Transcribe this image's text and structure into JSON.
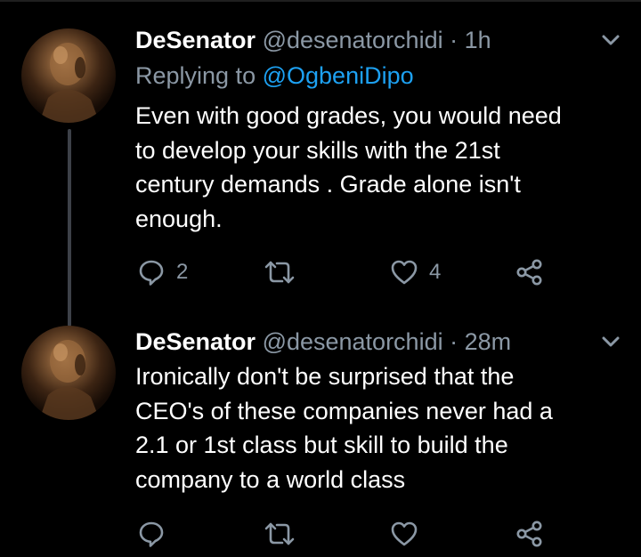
{
  "tweets": [
    {
      "display_name": "DeSenator",
      "handle": "@desenatorchidi",
      "separator": "·",
      "time": "1h",
      "replying_to_prefix": "Replying to",
      "replying_to_mention": "@OgbeniDipo",
      "lines": [
        "Even with good grades, you would need",
        "to develop your skills with the 21st",
        "century demands . Grade alone isn't",
        "enough."
      ],
      "reply_count": "2",
      "retweet_count": "",
      "like_count": "4"
    },
    {
      "display_name": "DeSenator",
      "handle": "@desenatorchidi",
      "separator": "·",
      "time": "28m",
      "lines": [
        "Ironically don't be surprised that the",
        "CEO's of these companies never had a",
        "2.1 or 1st class but skill to build the",
        "company to a world class"
      ],
      "reply_count": "",
      "retweet_count": "",
      "like_count": ""
    }
  ],
  "icons": {
    "reply": "reply-icon",
    "retweet": "retweet-icon",
    "like": "heart-icon",
    "share": "share-icon",
    "more": "chevron-down-icon"
  },
  "colors": {
    "background": "#000000",
    "text": "#ffffff",
    "secondary_text": "#8b98a5",
    "mention": "#1da1f2",
    "thread_line": "#3d4148"
  }
}
